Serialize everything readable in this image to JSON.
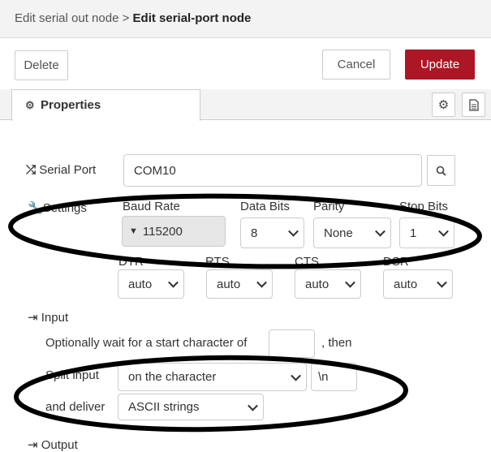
{
  "header": {
    "breadcrumb_parent": "Edit serial out node",
    "breadcrumb_sep": " > ",
    "title": "Edit serial-port node"
  },
  "toolbar": {
    "delete_label": "Delete",
    "cancel_label": "Cancel",
    "update_label": "Update",
    "accent_color": "#ad1625"
  },
  "tabs": {
    "properties_label": "Properties",
    "properties_icon": "gear-icon",
    "side_icons": [
      "gear-icon",
      "document-icon"
    ]
  },
  "serial_port": {
    "label": "Serial Port",
    "icon": "shuffle-icon",
    "value": "COM10",
    "search_icon": "search-icon"
  },
  "settings": {
    "label": "Settings",
    "icon": "wrench-icon",
    "baud_rate_label": "Baud Rate",
    "baud_rate_value": "115200",
    "data_bits_label": "Data Bits",
    "data_bits_value": "8",
    "parity_label": "Parity",
    "parity_value": "None",
    "stop_bits_label": "Stop Bits",
    "stop_bits_value": "1",
    "dtr_label": "DTR",
    "dtr_value": "auto",
    "rts_label": "RTS",
    "rts_value": "auto",
    "cts_label": "CTS",
    "cts_value": "auto",
    "dsr_label": "DSR",
    "dsr_value": "auto"
  },
  "input": {
    "label": "Input",
    "icon": "sign-in-icon",
    "start_char_text": "Optionally wait for a start character of",
    "start_char_value": "",
    "then_text": ", then",
    "split_label": "Split input",
    "split_value": "on the character",
    "split_char_value": "\\n",
    "deliver_label": "and deliver",
    "deliver_value": "ASCII strings"
  },
  "output": {
    "label": "Output",
    "icon": "sign-out-icon"
  }
}
